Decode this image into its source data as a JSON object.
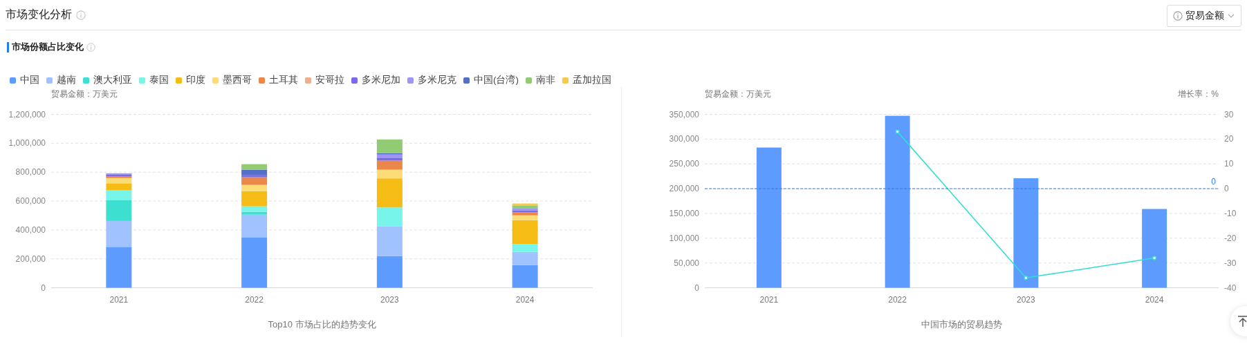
{
  "header": {
    "title": "市场变化分析",
    "metric_select": {
      "value": "贸易金额"
    }
  },
  "section": {
    "title": "市场份额占比变化",
    "charts": [
      {
        "chart_data": {
          "type": "bar",
          "stacked": true,
          "grid": true,
          "title": "Top10 市场占比的趋势变化",
          "ylabel": "贸易金额：万美元",
          "categories": [
            "2021",
            "2022",
            "2023",
            "2024"
          ],
          "ylim": [
            0,
            1200000
          ],
          "yticks": [
            {
              "value": 0,
              "label": "0"
            },
            {
              "value": 200000,
              "label": "200,000"
            },
            {
              "value": 400000,
              "label": "400,000"
            },
            {
              "value": 600000,
              "label": "600,000"
            },
            {
              "value": 800000,
              "label": "800,000"
            },
            {
              "value": 1000000,
              "label": "1,000,000"
            },
            {
              "value": 1200000,
              "label": "1,200,000"
            }
          ],
          "series": [
            {
              "name": "中国",
              "color": "#5d9cfe",
              "values": [
                283000,
                347000,
                220000,
                157000
              ]
            },
            {
              "name": "越南",
              "color": "#a0c2ff",
              "values": [
                179000,
                159000,
                204000,
                91000
              ]
            },
            {
              "name": "澳大利亚",
              "color": "#3ddfd0",
              "values": [
                143000,
                19000,
                0,
                0
              ]
            },
            {
              "name": "泰国",
              "color": "#78f5e9",
              "values": [
                69000,
                39000,
                132000,
                55000
              ]
            },
            {
              "name": "印度",
              "color": "#f5bc16",
              "values": [
                49000,
                104000,
                201000,
                165000
              ]
            },
            {
              "name": "墨西哥",
              "color": "#fddc77",
              "values": [
                36000,
                44000,
                60000,
                33000
              ]
            },
            {
              "name": "土耳其",
              "color": "#ec874a",
              "values": [
                13000,
                53000,
                63000,
                22000
              ]
            },
            {
              "name": "安哥拉",
              "color": "#f0ae89",
              "values": [
                0,
                0,
                0,
                0
              ]
            },
            {
              "name": "多米尼加",
              "color": "#7a69e8",
              "values": [
                10000,
                13000,
                20000,
                13000
              ]
            },
            {
              "name": "多米尼克",
              "color": "#9e95f5",
              "values": [
                10000,
                0,
                22000,
                12000
              ]
            },
            {
              "name": "中国(台湾)",
              "color": "#5470c6",
              "values": [
                0,
                39000,
                10000,
                0
              ]
            },
            {
              "name": "南非",
              "color": "#91cc75",
              "values": [
                0,
                38000,
                94000,
                22000
              ]
            },
            {
              "name": "孟加拉国",
              "color": "#f8c94a",
              "values": [
                0,
                0,
                0,
                13000
              ]
            }
          ]
        }
      },
      {
        "chart_data": {
          "type": "bar",
          "grid": true,
          "title": "中国市场的贸易趋势",
          "ylabel": "贸易金额：万美元",
          "y2label": "增长率：%",
          "categories": [
            "2021",
            "2022",
            "2023",
            "2024"
          ],
          "ylim": [
            0,
            350000
          ],
          "y2lim": [
            -40,
            30
          ],
          "yticks": [
            {
              "value": 0,
              "label": "0"
            },
            {
              "value": 50000,
              "label": "50,000"
            },
            {
              "value": 100000,
              "label": "100,000"
            },
            {
              "value": 150000,
              "label": "150,000"
            },
            {
              "value": 200000,
              "label": "200,000"
            },
            {
              "value": 250000,
              "label": "250,000"
            },
            {
              "value": 300000,
              "label": "300,000"
            },
            {
              "value": 350000,
              "label": "350,000"
            }
          ],
          "y2ticks": [
            {
              "value": -40,
              "label": "-40"
            },
            {
              "value": -30,
              "label": "-30"
            },
            {
              "value": -20,
              "label": "-20"
            },
            {
              "value": -10,
              "label": "-10"
            },
            {
              "value": 0,
              "label": "0"
            },
            {
              "value": 10,
              "label": "10"
            },
            {
              "value": 20,
              "label": "20"
            },
            {
              "value": 30,
              "label": "30"
            }
          ],
          "series": [
            {
              "type": "bar",
              "color": "#5d9cfe",
              "values": [
                283000,
                347000,
                221000,
                159000
              ]
            },
            {
              "type": "line",
              "axis": "y2",
              "marker": "circle",
              "color": "#2fe0d0",
              "values": [
                null,
                23,
                -36,
                -28
              ]
            }
          ],
          "ref_lines": [
            {
              "axis": "y2",
              "value": 0,
              "label": "0",
              "color": "#2f7bea"
            }
          ]
        }
      }
    ]
  }
}
